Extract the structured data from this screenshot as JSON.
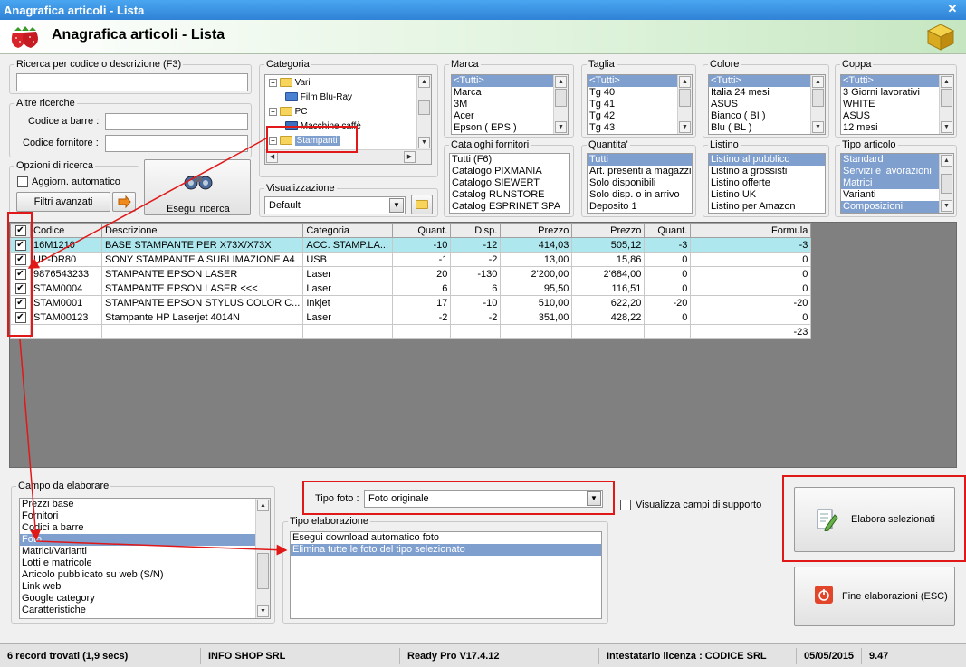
{
  "window": {
    "title": "Anagrafica articoli  - Lista",
    "header_title": "Anagrafica articoli  - Lista",
    "close_glyph": "✕"
  },
  "search": {
    "group_label": "Ricerca per codice o descrizione (F3)",
    "value": "",
    "other_label": "Altre ricerche",
    "barcode_label": "Codice a barre  :",
    "supplier_code_label": "Codice fornitore :",
    "options_label": "Opzioni di ricerca",
    "auto_update_label": "Aggiorn. automatico",
    "advanced_filters_label": "Filtri avanzati",
    "run_button_label": "Esegui ricerca"
  },
  "categoria": {
    "label": "Categoria",
    "nodes": [
      {
        "label": "Vari",
        "expander": "+"
      },
      {
        "label": "Film Blu-Ray",
        "expander": ""
      },
      {
        "label": "PC",
        "expander": "+"
      },
      {
        "label": "Macchine caffè",
        "expander": ""
      },
      {
        "label": "Stampanti",
        "expander": "+"
      }
    ]
  },
  "visualizzazione": {
    "label": "Visualizzazione",
    "value": "Default"
  },
  "marca": {
    "label": "Marca",
    "items": [
      "<Tutti>",
      "Marca",
      "3M",
      "Acer",
      "Epson ( EPS )"
    ]
  },
  "taglia": {
    "label": "Taglia",
    "items": [
      "<Tutti>",
      "Tg 40",
      "Tg 41",
      "Tg 42",
      "Tg 43"
    ]
  },
  "colore": {
    "label": "Colore",
    "items": [
      "<Tutti>",
      "Italia 24 mesi",
      "ASUS",
      "Bianco ( BI )",
      "Blu ( BL )"
    ]
  },
  "coppa": {
    "label": "Coppa",
    "items": [
      "<Tutti>",
      "3 Giorni lavorativi",
      "WHITE",
      "ASUS",
      "12 mesi"
    ]
  },
  "cataloghi": {
    "label": "Cataloghi fornitori",
    "items": [
      "Tutti (F6)",
      "Catalogo PIXMANIA",
      "Catalogo SIEWERT",
      "Catalog RUNSTORE",
      "Catalog ESPRINET SPA"
    ]
  },
  "quantita": {
    "label": "Quantita'",
    "items": [
      "Tutti",
      "Art. presenti a magazzino",
      "Solo disponibili",
      "Solo disp. o in arrivo",
      "Deposito 1"
    ]
  },
  "listino": {
    "label": "Listino",
    "items": [
      "Listino al pubblico",
      "Listino a grossisti",
      "Listino offerte",
      "Listino UK",
      "Listino per Amazon"
    ]
  },
  "tipo_articolo": {
    "label": "Tipo articolo",
    "items": [
      "Standard",
      "Servizi e lavorazioni",
      "Matrici",
      "Varianti",
      "Composizioni"
    ]
  },
  "grid": {
    "columns": [
      "",
      "Codice",
      "Descrizione",
      "Categoria",
      "Quant.",
      "Disp.",
      "Prezzo",
      "Prezzo",
      "Quant.",
      "Formula"
    ],
    "header_check": "✔",
    "rows": [
      {
        "check": "✔",
        "codice": "16M1210",
        "descrizione": "BASE STAMPANTE PER X73X/X73X",
        "categoria": "ACC. STAMP.LA...",
        "quant": "-10",
        "disp": "-12",
        "prezzo1": "414,03",
        "prezzo2": "505,12",
        "quant2": "-3",
        "formula": "-3"
      },
      {
        "check": "✔",
        "codice": "UP-DR80",
        "descrizione": "SONY STAMPANTE A SUBLIMAZIONE A4",
        "categoria": "USB",
        "quant": "-1",
        "disp": "-2",
        "prezzo1": "13,00",
        "prezzo2": "15,86",
        "quant2": "0",
        "formula": "0"
      },
      {
        "check": "✔",
        "codice": "9876543233",
        "descrizione": "STAMPANTE EPSON LASER",
        "categoria": "Laser",
        "quant": "20",
        "disp": "-130",
        "prezzo1": "2'200,00",
        "prezzo2": "2'684,00",
        "quant2": "0",
        "formula": "0"
      },
      {
        "check": "✔",
        "codice": "STAM0004",
        "descrizione": "STAMPANTE EPSON LASER <<<",
        "categoria": "Laser",
        "quant": "6",
        "disp": "6",
        "prezzo1": "95,50",
        "prezzo2": "116,51",
        "quant2": "0",
        "formula": "0"
      },
      {
        "check": "✔",
        "codice": "STAM0001",
        "descrizione": "STAMPANTE EPSON STYLUS COLOR C...",
        "categoria": "Inkjet",
        "quant": "17",
        "disp": "-10",
        "prezzo1": "510,00",
        "prezzo2": "622,20",
        "quant2": "-20",
        "formula": "-20"
      },
      {
        "check": "✔",
        "codice": "STAM00123",
        "descrizione": "Stampante HP Laserjet 4014N",
        "categoria": "Laser",
        "quant": "-2",
        "disp": "-2",
        "prezzo1": "351,00",
        "prezzo2": "428,22",
        "quant2": "0",
        "formula": "0"
      }
    ],
    "total_formula": "-23"
  },
  "campo": {
    "label": "Campo da elaborare",
    "items": [
      "Prezzi base",
      "Fornitori",
      "Codici a barre",
      "Foto",
      "Matrici/Varianti",
      "Lotti e matricole",
      "Articolo pubblicato su web (S/N)",
      "Link web",
      "Google category",
      "Caratteristiche"
    ]
  },
  "tipo_foto": {
    "label": "Tipo foto :",
    "value": "Foto originale"
  },
  "supporto": {
    "label": "Visualizza campi di supporto"
  },
  "tipo_elaborazione": {
    "label": "Tipo elaborazione",
    "items": [
      "Esegui download automatico foto",
      "Elimina tutte le foto del tipo selezionato"
    ]
  },
  "actions": {
    "process_label": "Elabora selezionati",
    "end_label": "Fine elaborazioni (ESC)"
  },
  "status": {
    "records": "6 record trovati (1,9 secs)",
    "company": "INFO SHOP SRL",
    "version": "Ready Pro V17.4.12",
    "license": "Intestatario licenza : CODICE SRL",
    "date": "05/05/2015",
    "number": "9.47"
  }
}
